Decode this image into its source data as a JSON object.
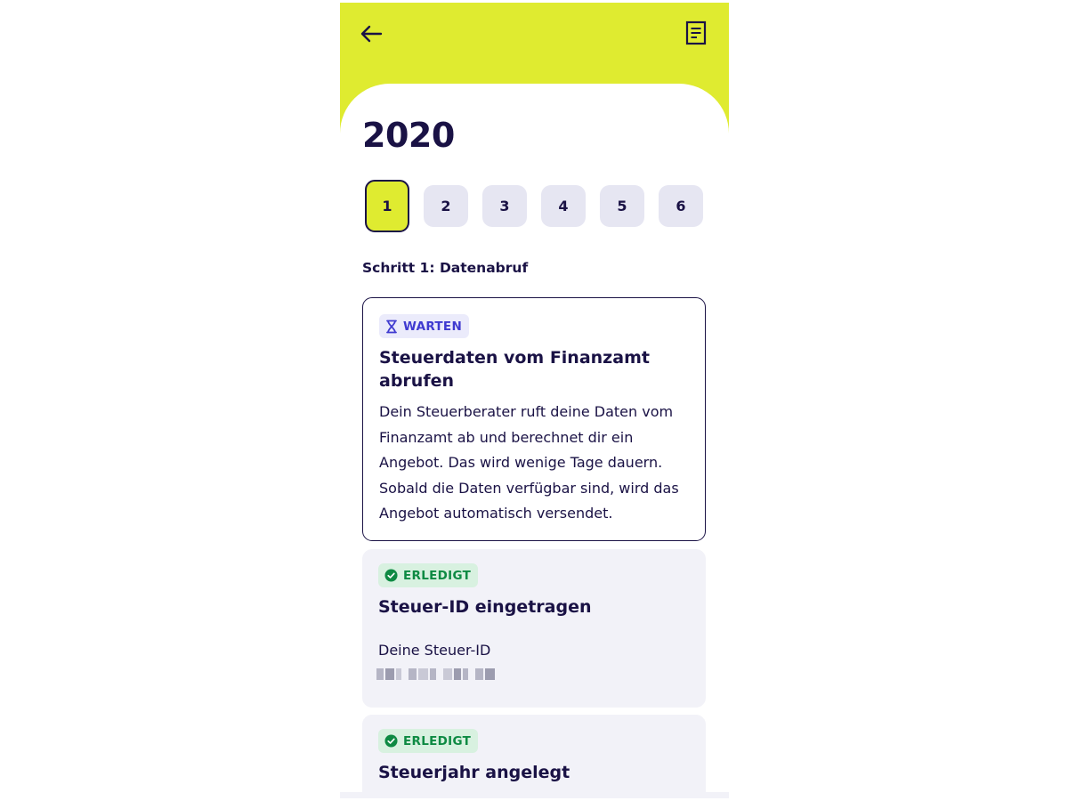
{
  "header": {
    "back_icon": "arrow-left-icon",
    "document_icon": "document-icon",
    "brand_color": "#dfeb30"
  },
  "year": "2020",
  "steps": [
    {
      "label": "1",
      "active": true
    },
    {
      "label": "2",
      "active": false
    },
    {
      "label": "3",
      "active": false
    },
    {
      "label": "4",
      "active": false
    },
    {
      "label": "5",
      "active": false
    },
    {
      "label": "6",
      "active": false
    }
  ],
  "step_title": "Schritt 1: Datenabruf",
  "cards": {
    "pending": {
      "badge": "WARTEN",
      "badge_icon": "hourglass-icon",
      "title": "Steuerdaten vom Finanzamt abrufen",
      "description": "Dein Steuerberater ruft deine Daten vom Finanzamt ab und berechnet dir ein Angebot. Das wird wenige Tage dauern. Sobald die Daten verfügbar sind, wird das Angebot automatisch versendet."
    },
    "tax_id": {
      "badge": "ERLEDIGT",
      "badge_icon": "check-circle-icon",
      "title": "Steuer-ID eingetragen",
      "field_label": "Deine Steuer-ID"
    },
    "tax_year": {
      "badge": "ERLEDIGT",
      "badge_icon": "check-circle-icon",
      "title": "Steuerjahr angelegt"
    }
  },
  "colors": {
    "navy": "#1a1245",
    "wait_badge": "#3f3ad0",
    "done_badge": "#0e8a43"
  }
}
